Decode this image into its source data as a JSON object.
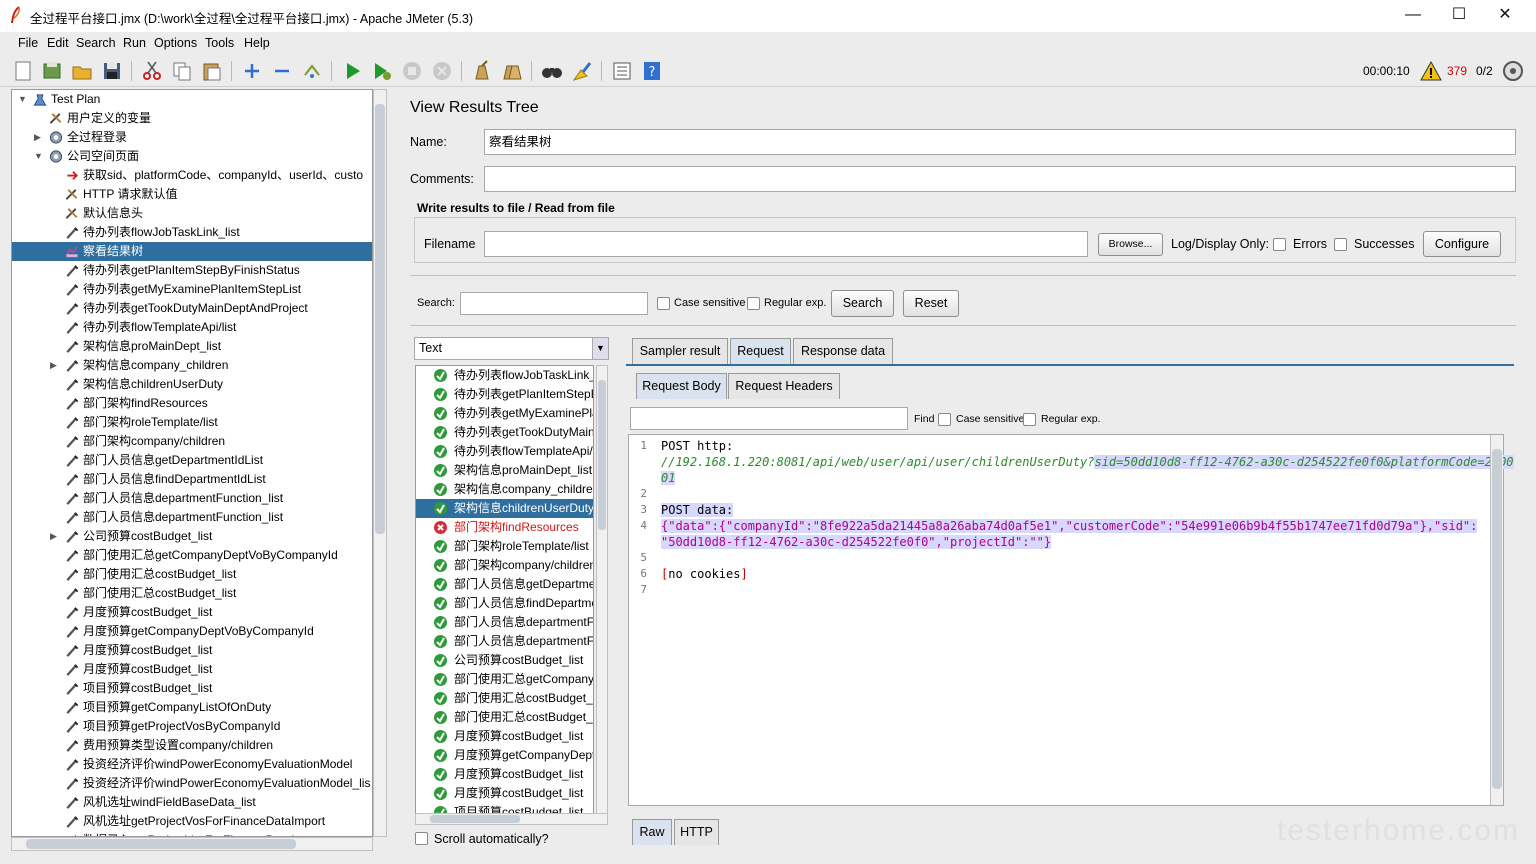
{
  "window": {
    "title": "全过程平台接口.jmx (D:\\work\\全过程\\全过程平台接口.jmx) - Apache JMeter (5.3)",
    "minimize": "—",
    "maximize": "☐",
    "close": "✕"
  },
  "menu": [
    "File",
    "Edit",
    "Search",
    "Run",
    "Options",
    "Tools",
    "Help"
  ],
  "toolbar": {
    "icons": [
      "new-icon",
      "templates-icon",
      "open-icon",
      "save-icon",
      "cut-icon",
      "copy-icon",
      "paste-icon",
      "expand-icon",
      "collapse-icon",
      "toggle-icon",
      "start-icon",
      "start-no-pause-icon",
      "stop-icon",
      "shutdown-icon",
      "clear-icon",
      "clear-all-icon",
      "search-icon",
      "reset-search-icon",
      "function-helper-icon",
      "help-icon"
    ],
    "timer": "00:00:10",
    "warnings": "379",
    "threads": "0/2"
  },
  "tree": {
    "items": [
      {
        "label": "Test Plan",
        "icon": "testplan-icon",
        "level": 0,
        "arrow": "▼"
      },
      {
        "label": "用户定义的变量",
        "icon": "config-icon",
        "level": 1
      },
      {
        "label": "全过程登录",
        "icon": "gear-icon",
        "level": 1,
        "arrow": "▶"
      },
      {
        "label": "公司空间页面",
        "icon": "gear-icon",
        "level": 1,
        "arrow": "▼"
      },
      {
        "label": "获取sid、platformCode、companyId、userId、custo",
        "icon": "preprocessor-icon",
        "level": 2
      },
      {
        "label": "HTTP 请求默认值",
        "icon": "config-icon",
        "level": 2
      },
      {
        "label": "默认信息头",
        "icon": "config-icon",
        "level": 2
      },
      {
        "label": "待办列表flowJobTaskLink_list",
        "icon": "sampler-icon",
        "level": 2
      },
      {
        "label": "察看结果树",
        "icon": "listener-icon",
        "level": 2,
        "selected": true
      },
      {
        "label": "待办列表getPlanItemStepByFinishStatus",
        "icon": "sampler-icon",
        "level": 2
      },
      {
        "label": "待办列表getMyExaminePlanItemStepList",
        "icon": "sampler-icon",
        "level": 2
      },
      {
        "label": "待办列表getTookDutyMainDeptAndProject",
        "icon": "sampler-icon",
        "level": 2
      },
      {
        "label": "待办列表flowTemplateApi/list",
        "icon": "sampler-icon",
        "level": 2
      },
      {
        "label": "架构信息proMainDept_list",
        "icon": "sampler-icon",
        "level": 2
      },
      {
        "label": "架构信息company_children",
        "icon": "sampler-icon",
        "level": 2,
        "arrow": "▶"
      },
      {
        "label": "架构信息childrenUserDuty",
        "icon": "sampler-icon",
        "level": 2
      },
      {
        "label": "部门架构findResources",
        "icon": "sampler-icon",
        "level": 2
      },
      {
        "label": "部门架构roleTemplate/list",
        "icon": "sampler-icon",
        "level": 2
      },
      {
        "label": "部门架构company/children",
        "icon": "sampler-icon",
        "level": 2
      },
      {
        "label": "部门人员信息getDepartmentIdList",
        "icon": "sampler-icon",
        "level": 2
      },
      {
        "label": "部门人员信息findDepartmentIdList",
        "icon": "sampler-icon",
        "level": 2
      },
      {
        "label": "部门人员信息departmentFunction_list",
        "icon": "sampler-icon",
        "level": 2
      },
      {
        "label": "部门人员信息departmentFunction_list",
        "icon": "sampler-icon",
        "level": 2
      },
      {
        "label": "公司预算costBudget_list",
        "icon": "sampler-icon",
        "level": 2,
        "arrow": "▶"
      },
      {
        "label": "部门使用汇总getCompanyDeptVoByCompanyId",
        "icon": "sampler-icon",
        "level": 2
      },
      {
        "label": "部门使用汇总costBudget_list",
        "icon": "sampler-icon",
        "level": 2
      },
      {
        "label": "部门使用汇总costBudget_list",
        "icon": "sampler-icon",
        "level": 2
      },
      {
        "label": "月度预算costBudget_list",
        "icon": "sampler-icon",
        "level": 2
      },
      {
        "label": "月度预算getCompanyDeptVoByCompanyId",
        "icon": "sampler-icon",
        "level": 2
      },
      {
        "label": "月度预算costBudget_list",
        "icon": "sampler-icon",
        "level": 2
      },
      {
        "label": "月度预算costBudget_list",
        "icon": "sampler-icon",
        "level": 2
      },
      {
        "label": "项目预算costBudget_list",
        "icon": "sampler-icon",
        "level": 2
      },
      {
        "label": "项目预算getCompanyListOfOnDuty",
        "icon": "sampler-icon",
        "level": 2
      },
      {
        "label": "项目预算getProjectVosByCompanyId",
        "icon": "sampler-icon",
        "level": 2
      },
      {
        "label": "费用预算类型设置company/children",
        "icon": "sampler-icon",
        "level": 2
      },
      {
        "label": "投资经济评价windPowerEconomyEvaluationModel",
        "icon": "sampler-icon",
        "level": 2
      },
      {
        "label": "投资经济评价windPowerEconomyEvaluationModel_lis",
        "icon": "sampler-icon",
        "level": 2
      },
      {
        "label": "风机选址windFieldBaseData_list",
        "icon": "sampler-icon",
        "level": 2
      },
      {
        "label": "风机选址getProjectVosForFinanceDataImport",
        "icon": "sampler-icon",
        "level": 2
      },
      {
        "label": "数据录入getProjectVosForFinanceDataImport",
        "icon": "sampler-icon",
        "level": 2
      }
    ]
  },
  "panel": {
    "heading": "View Results Tree",
    "name_label": "Name:",
    "name_value": "察看结果树",
    "comments_label": "Comments:",
    "comments_value": "",
    "file_section": "Write results to file / Read from file",
    "filename_label": "Filename",
    "filename_value": "",
    "browse": "Browse...",
    "log_display": "Log/Display Only:",
    "errors": "Errors",
    "successes": "Successes",
    "configure": "Configure",
    "search_label": "Search:",
    "search_value": "",
    "case_sensitive": "Case sensitive",
    "regex": "Regular exp.",
    "search_btn": "Search",
    "reset_btn": "Reset",
    "renderer": "Text",
    "scroll_auto": "Scroll automatically?"
  },
  "samples": [
    {
      "label": "待办列表flowJobTaskLink_list",
      "ok": true
    },
    {
      "label": "待办列表getPlanItemStepByFinishStatus",
      "ok": true
    },
    {
      "label": "待办列表getMyExaminePlanItemStepList",
      "ok": true
    },
    {
      "label": "待办列表getTookDutyMainDeptAndProject",
      "ok": true
    },
    {
      "label": "待办列表flowTemplateApi/list",
      "ok": true
    },
    {
      "label": "架构信息proMainDept_list",
      "ok": true
    },
    {
      "label": "架构信息company_children",
      "ok": true
    },
    {
      "label": "架构信息childrenUserDuty",
      "ok": true,
      "selected": true
    },
    {
      "label": "部门架构findResources",
      "ok": false
    },
    {
      "label": "部门架构roleTemplate/list",
      "ok": true
    },
    {
      "label": "部门架构company/children",
      "ok": true
    },
    {
      "label": "部门人员信息getDepartmentIdList",
      "ok": true
    },
    {
      "label": "部门人员信息findDepartmentIdList",
      "ok": true
    },
    {
      "label": "部门人员信息departmentFunction_list",
      "ok": true
    },
    {
      "label": "部门人员信息departmentFunction_list",
      "ok": true
    },
    {
      "label": "公司预算costBudget_list",
      "ok": true
    },
    {
      "label": "部门使用汇总getCompanyDeptVoByCompanyId",
      "ok": true
    },
    {
      "label": "部门使用汇总costBudget_list",
      "ok": true
    },
    {
      "label": "部门使用汇总costBudget_list",
      "ok": true
    },
    {
      "label": "月度预算costBudget_list",
      "ok": true
    },
    {
      "label": "月度预算getCompanyDeptVoByCompanyId",
      "ok": true
    },
    {
      "label": "月度预算costBudget_list",
      "ok": true
    },
    {
      "label": "月度预算costBudget_list",
      "ok": true
    },
    {
      "label": "项目预算costBudget_list",
      "ok": true
    }
  ],
  "result_tabs": [
    "Sampler result",
    "Request",
    "Response data"
  ],
  "request_tabs": [
    "Request Body",
    "Request Headers"
  ],
  "find": {
    "label": "Find",
    "value": "",
    "case_sensitive": "Case sensitive",
    "regex": "Regular exp."
  },
  "code_lines": [
    {
      "n": "1",
      "parts": [
        {
          "t": "POST http:",
          "c": ""
        }
      ]
    },
    {
      "n": "",
      "parts": [
        {
          "t": "//192.168.1.220:8081/api/web/user/api/user/childrenUserDuty?",
          "c": "green"
        },
        {
          "t": "sid=50dd10d8-ff12-4762-a30c-d254522fe0f0&platformCode=2000",
          "c": "green hl"
        }
      ]
    },
    {
      "n": "",
      "parts": [
        {
          "t": "01",
          "c": "green hl"
        }
      ]
    },
    {
      "n": "2",
      "parts": []
    },
    {
      "n": "3",
      "parts": [
        {
          "t": "POST data:",
          "c": "hl"
        }
      ]
    },
    {
      "n": "4",
      "parts": [
        {
          "t": "{\"data\":{\"companyId\":\"8fe922a5da21445a8a26aba74d0af5e1\",\"customerCode\":\"54e991e06b9b4f55b1747ee71fd0d79a\"},\"sid\":",
          "c": "mag hl"
        }
      ]
    },
    {
      "n": "",
      "parts": [
        {
          "t": "\"50dd10d8-ff12-4762-a30c-d254522fe0f0\",\"projectId\":\"\"}",
          "c": "mag hl"
        }
      ]
    },
    {
      "n": "5",
      "parts": []
    },
    {
      "n": "6",
      "parts": [
        {
          "t": "[",
          "c": "red"
        },
        {
          "t": "no cookies",
          "c": ""
        },
        {
          "t": "]",
          "c": "red"
        }
      ]
    },
    {
      "n": "7",
      "parts": []
    }
  ],
  "bottom_tabs": [
    "Raw",
    "HTTP"
  ],
  "watermark": "testerhome.com"
}
